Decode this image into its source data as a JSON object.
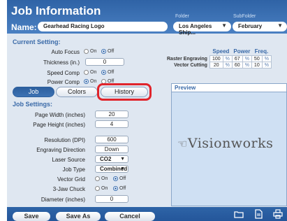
{
  "header": {
    "title": "Job Information",
    "name_label": "Name:",
    "name_value": "Gearhead Racing Logo",
    "folder_label": "Folder",
    "folder_value": "Los Angeles Ship...",
    "subfolder_label": "SubFolder",
    "subfolder_value": "February"
  },
  "current_setting": {
    "title": "Current Setting:",
    "auto_focus_label": "Auto Focus",
    "thickness_label": "Thickness (in.)",
    "thickness_value": "0",
    "speed_comp_label": "Speed Comp",
    "power_comp_label": "Power Comp",
    "on": "On",
    "off": "Off"
  },
  "speed_table": {
    "headers": [
      "Speed",
      "Power",
      "Freq."
    ],
    "rows": [
      {
        "label": "Raster Engraving",
        "speed": "100",
        "power": "67",
        "freq": "50"
      },
      {
        "label": "Vector Cutting",
        "speed": "20",
        "power": "60",
        "freq": "10"
      }
    ],
    "pct": "%"
  },
  "tabs": {
    "job": "Job",
    "colors": "Colors",
    "history": "History"
  },
  "job_settings": {
    "title": "Job Settings:",
    "page_width_label": "Page Width (inches)",
    "page_width_value": "20",
    "page_height_label": "Page Height (inches)",
    "page_height_value": "4",
    "resolution_label": "Resolution (DPI)",
    "resolution_value": "600",
    "engraving_direction_label": "Engraving Direction",
    "engraving_direction_value": "Down",
    "laser_source_label": "Laser Source",
    "laser_source_value": "CO2",
    "job_type_label": "Job Type",
    "job_type_value": "Combined",
    "vector_grid_label": "Vector Grid",
    "three_jaw_label": "3-Jaw Chuck",
    "diameter_label": "Diameter (inches)",
    "diameter_value": "0"
  },
  "preview": {
    "title": "Preview",
    "logo_text": "Visionworks"
  },
  "footer": {
    "save": "Save",
    "save_as": "Save As",
    "cancel": "Cancel"
  },
  "icons": [
    "folder-icon",
    "document-icon",
    "printer-icon",
    "chevron-down-icon"
  ]
}
